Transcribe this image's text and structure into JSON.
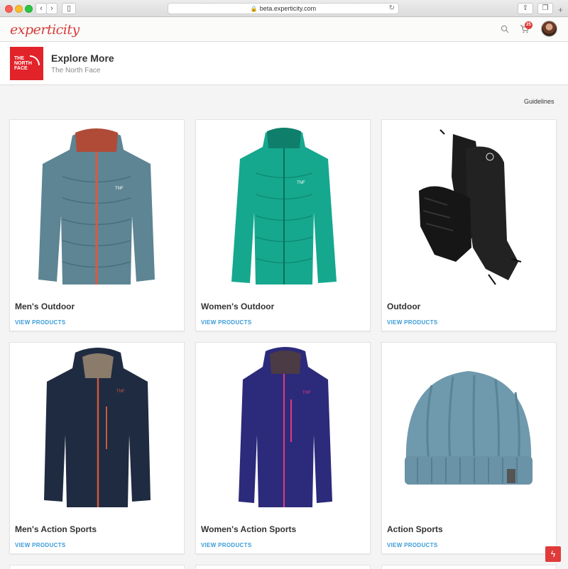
{
  "browser": {
    "url": "beta.experticity.com"
  },
  "header": {
    "logo": "experticity",
    "cart_count": "25"
  },
  "brand": {
    "title": "Explore More",
    "subtitle": "The North Face",
    "logo_text": "THE NORTH FACE"
  },
  "guidelines_label": "Guidelines",
  "cards": [
    {
      "title": "Men's Outdoor",
      "link": "VIEW PRODUCTS",
      "image": "mens-down-jacket"
    },
    {
      "title": "Women's Outdoor",
      "link": "VIEW PRODUCTS",
      "image": "womens-down-jacket"
    },
    {
      "title": "Outdoor",
      "link": "VIEW PRODUCTS",
      "image": "gloves"
    },
    {
      "title": "Men's Action Sports",
      "link": "VIEW PRODUCTS",
      "image": "mens-shell-jacket"
    },
    {
      "title": "Women's Action Sports",
      "link": "VIEW PRODUCTS",
      "image": "womens-shell-jacket"
    },
    {
      "title": "Action Sports",
      "link": "VIEW PRODUCTS",
      "image": "beanie"
    }
  ],
  "colors": {
    "accent": "#e03b3b",
    "link": "#3a9bd8",
    "brand_red": "#e2232a"
  }
}
